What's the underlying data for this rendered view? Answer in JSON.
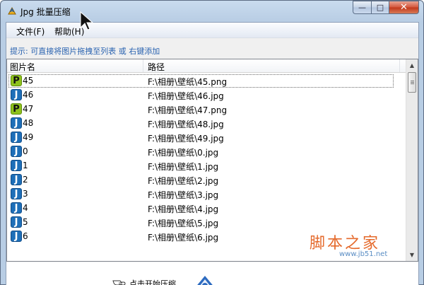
{
  "window": {
    "title": "Jpg 批量压缩"
  },
  "title_buttons": {
    "minimize": "—",
    "maximize": "□",
    "close": "✕"
  },
  "menu": [
    {
      "label": "文件(F)"
    },
    {
      "label": "帮助(H)"
    }
  ],
  "hint": "提示: 可直接将图片拖拽至列表 或 右键添加",
  "list": {
    "columns": [
      "图片名",
      "路径"
    ],
    "rows": [
      {
        "type": "P",
        "name": "45",
        "path": "F:\\相册\\壁纸\\45.png",
        "selected": true
      },
      {
        "type": "J",
        "name": "46",
        "path": "F:\\相册\\壁纸\\46.jpg"
      },
      {
        "type": "P",
        "name": "47",
        "path": "F:\\相册\\壁纸\\47.png"
      },
      {
        "type": "J",
        "name": "48",
        "path": "F:\\相册\\壁纸\\48.jpg"
      },
      {
        "type": "J",
        "name": "49",
        "path": "F:\\相册\\壁纸\\49.jpg"
      },
      {
        "type": "J",
        "name": "0",
        "path": "F:\\相册\\壁纸\\0.jpg"
      },
      {
        "type": "J",
        "name": "1",
        "path": "F:\\相册\\壁纸\\1.jpg"
      },
      {
        "type": "J",
        "name": "2",
        "path": "F:\\相册\\壁纸\\2.jpg"
      },
      {
        "type": "J",
        "name": "3",
        "path": "F:\\相册\\壁纸\\3.jpg"
      },
      {
        "type": "J",
        "name": "4",
        "path": "F:\\相册\\壁纸\\4.jpg"
      },
      {
        "type": "J",
        "name": "5",
        "path": "F:\\相册\\壁纸\\5.jpg"
      },
      {
        "type": "J",
        "name": "6",
        "path": "F:\\相册\\壁纸\\6.jpg"
      }
    ]
  },
  "scrollbar": {
    "up": "▲",
    "down": "▼"
  },
  "start_hint": "点击开始压缩.",
  "watermark": {
    "main": "脚本之家",
    "url": "www.jb51.net"
  },
  "colors": {
    "png_icon": "#8fc21c",
    "jpg_icon": "#1e6fb8",
    "hint_text": "#2a63b0",
    "watermark": "#e56a2c"
  },
  "icons": {
    "app": "app-icon",
    "png": "png-file-icon",
    "jpg": "jpg-file-icon",
    "hand": "pointing-hand-icon",
    "start": "start-compress-logo"
  }
}
